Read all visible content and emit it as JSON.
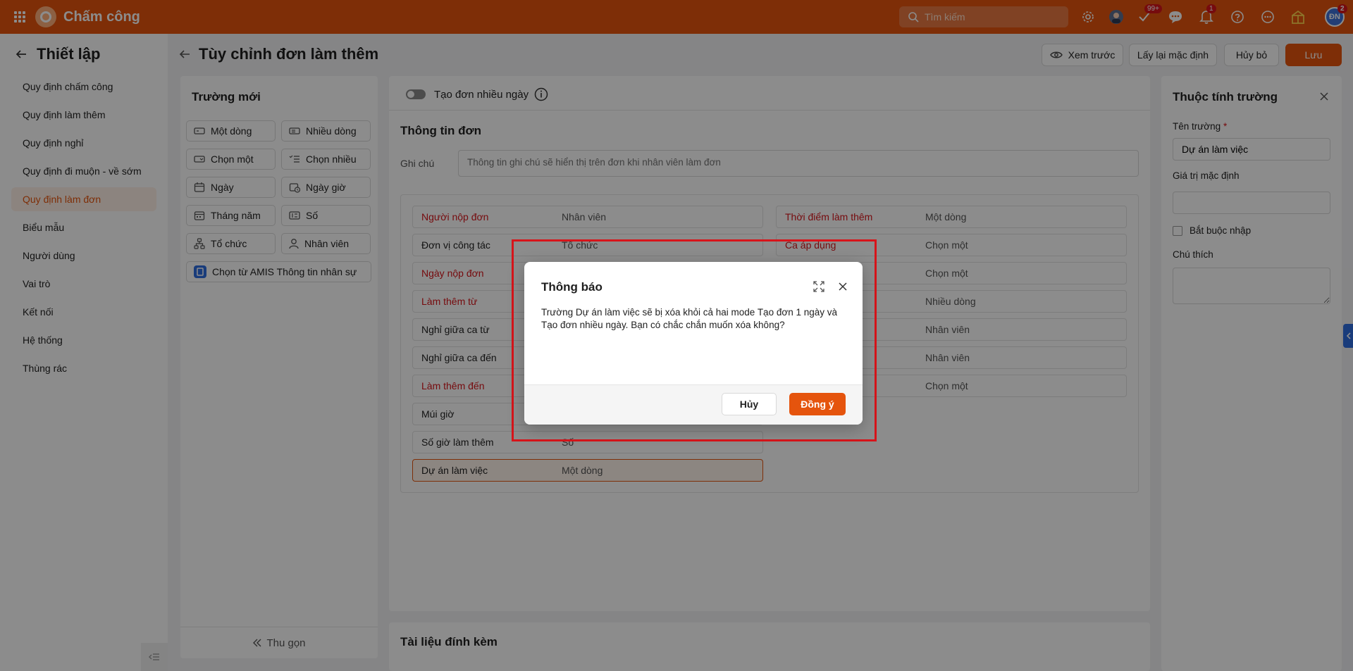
{
  "app": {
    "title": "Chấm công",
    "search_placeholder": "Tìm kiếm",
    "badge_tasks": "99+",
    "badge_notifications": "1",
    "badge_avatar": "2",
    "avatar_initials": "ĐN"
  },
  "sidebar": {
    "title": "Thiết lập",
    "items": [
      {
        "label": "Quy định chấm công"
      },
      {
        "label": "Quy định làm thêm"
      },
      {
        "label": "Quy định nghỉ"
      },
      {
        "label": "Quy định đi muộn - về sớm"
      },
      {
        "label": "Quy định làm đơn",
        "active": true
      },
      {
        "label": "Biểu mẫu"
      },
      {
        "label": "Người dùng"
      },
      {
        "label": "Vai trò"
      },
      {
        "label": "Kết nối"
      },
      {
        "label": "Hệ thống"
      },
      {
        "label": "Thùng rác"
      }
    ]
  },
  "header": {
    "title": "Tùy chỉnh đơn làm thêm",
    "preview_label": "Xem trước",
    "reset_label": "Lấy lại mặc định",
    "cancel_label": "Hủy bỏ",
    "save_label": "Lưu"
  },
  "fields_panel": {
    "title": "Trường mới",
    "types": [
      "Một dòng",
      "Nhiều dòng",
      "Chọn một",
      "Chọn nhiều",
      "Ngày",
      "Ngày giờ",
      "Tháng năm",
      "Số",
      "Tổ chức",
      "Nhân viên"
    ],
    "amis_label": "Chọn từ AMIS Thông tin nhân sự",
    "collapse_label": "Thu gọn"
  },
  "form": {
    "multi_day_label": "Tạo đơn nhiều ngày",
    "section_title": "Thông tin đơn",
    "note_label": "Ghi chú",
    "note_placeholder": "Thông tin ghi chú sẽ hiển thị trên đơn khi nhân viên làm đơn",
    "left_rows": [
      {
        "label": "Người nộp đơn",
        "value": "Nhân viên",
        "required": true
      },
      {
        "label": "Đơn vị công tác",
        "value": "Tổ chức",
        "required": false
      },
      {
        "label": "Ngày nộp đơn",
        "value": "",
        "required": true
      },
      {
        "label": "Làm thêm từ",
        "value": "",
        "required": true
      },
      {
        "label": "Nghỉ giữa ca từ",
        "value": "",
        "required": false
      },
      {
        "label": "Nghỉ giữa ca đến",
        "value": "",
        "required": false
      },
      {
        "label": "Làm thêm đến",
        "value": "",
        "required": true
      },
      {
        "label": "Múi giờ",
        "value": "",
        "required": false
      },
      {
        "label": "Số giờ làm thêm",
        "value": "Số",
        "required": false
      },
      {
        "label": "Dự án làm việc",
        "value": "Một dòng",
        "required": false,
        "selected": true
      }
    ],
    "right_rows": [
      {
        "label": "Thời điểm làm thêm",
        "value": "Một dòng",
        "required": true
      },
      {
        "label": "Ca áp dụng",
        "value": "Chọn một",
        "required": true
      },
      {
        "label": "",
        "value": "Chọn một",
        "required": false
      },
      {
        "label": "",
        "value": "Nhiều dòng",
        "required": false
      },
      {
        "label": "",
        "value": "Nhân viên",
        "required": false
      },
      {
        "label": "",
        "value": "Nhân viên",
        "required": false
      },
      {
        "label": "",
        "value": "Chọn một",
        "required": false
      }
    ],
    "attachments_title": "Tài liệu đính kèm"
  },
  "properties": {
    "title": "Thuộc tính trường",
    "name_label": "Tên trường",
    "name_value": "Dự án làm việc",
    "default_label": "Giá trị mặc định",
    "default_value": "",
    "required_label": "Bắt buộc nhập",
    "note_label": "Chú thích"
  },
  "dialog": {
    "title": "Thông báo",
    "message": "Trường Dự án làm việc sẽ bị xóa khỏi cả hai mode Tạo đơn 1 ngày và Tạo đơn nhiều ngày. Bạn có chắc chắn muốn xóa không?",
    "cancel_label": "Hủy",
    "confirm_label": "Đồng ý"
  },
  "colors": {
    "brand": "#e5540d",
    "required": "#d7141a",
    "highlight": "#d7141a"
  }
}
